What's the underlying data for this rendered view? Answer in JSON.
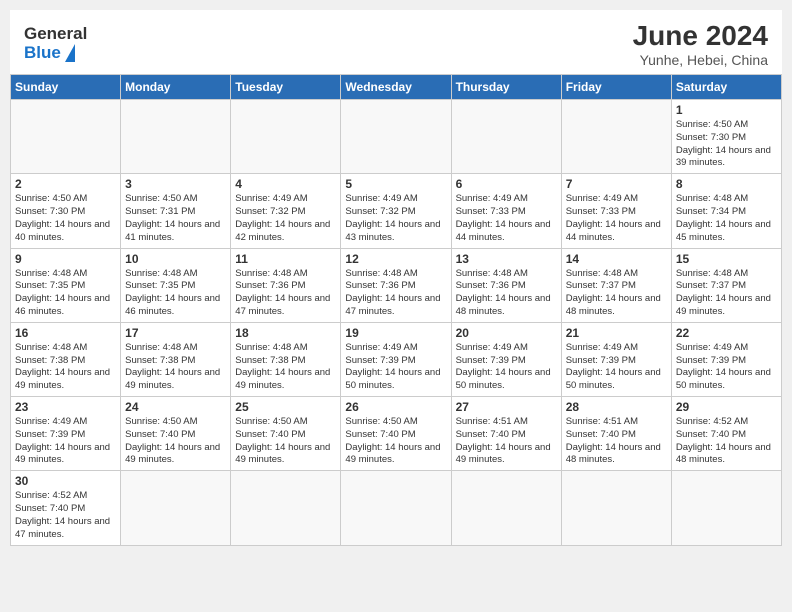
{
  "header": {
    "logo_general": "General",
    "logo_blue": "Blue",
    "month_year": "June 2024",
    "location": "Yunhe, Hebei, China"
  },
  "weekdays": [
    "Sunday",
    "Monday",
    "Tuesday",
    "Wednesday",
    "Thursday",
    "Friday",
    "Saturday"
  ],
  "weeks": [
    [
      {
        "day": "",
        "info": ""
      },
      {
        "day": "",
        "info": ""
      },
      {
        "day": "",
        "info": ""
      },
      {
        "day": "",
        "info": ""
      },
      {
        "day": "",
        "info": ""
      },
      {
        "day": "",
        "info": ""
      },
      {
        "day": "1",
        "info": "Sunrise: 4:50 AM\nSunset: 7:30 PM\nDaylight: 14 hours and 39 minutes."
      }
    ],
    [
      {
        "day": "2",
        "info": "Sunrise: 4:50 AM\nSunset: 7:30 PM\nDaylight: 14 hours and 40 minutes."
      },
      {
        "day": "3",
        "info": "Sunrise: 4:50 AM\nSunset: 7:31 PM\nDaylight: 14 hours and 41 minutes."
      },
      {
        "day": "4",
        "info": "Sunrise: 4:49 AM\nSunset: 7:32 PM\nDaylight: 14 hours and 42 minutes."
      },
      {
        "day": "5",
        "info": "Sunrise: 4:49 AM\nSunset: 7:32 PM\nDaylight: 14 hours and 43 minutes."
      },
      {
        "day": "6",
        "info": "Sunrise: 4:49 AM\nSunset: 7:33 PM\nDaylight: 14 hours and 44 minutes."
      },
      {
        "day": "7",
        "info": "Sunrise: 4:49 AM\nSunset: 7:33 PM\nDaylight: 14 hours and 44 minutes."
      },
      {
        "day": "8",
        "info": "Sunrise: 4:48 AM\nSunset: 7:34 PM\nDaylight: 14 hours and 45 minutes."
      }
    ],
    [
      {
        "day": "9",
        "info": "Sunrise: 4:48 AM\nSunset: 7:35 PM\nDaylight: 14 hours and 46 minutes."
      },
      {
        "day": "10",
        "info": "Sunrise: 4:48 AM\nSunset: 7:35 PM\nDaylight: 14 hours and 46 minutes."
      },
      {
        "day": "11",
        "info": "Sunrise: 4:48 AM\nSunset: 7:36 PM\nDaylight: 14 hours and 47 minutes."
      },
      {
        "day": "12",
        "info": "Sunrise: 4:48 AM\nSunset: 7:36 PM\nDaylight: 14 hours and 47 minutes."
      },
      {
        "day": "13",
        "info": "Sunrise: 4:48 AM\nSunset: 7:36 PM\nDaylight: 14 hours and 48 minutes."
      },
      {
        "day": "14",
        "info": "Sunrise: 4:48 AM\nSunset: 7:37 PM\nDaylight: 14 hours and 48 minutes."
      },
      {
        "day": "15",
        "info": "Sunrise: 4:48 AM\nSunset: 7:37 PM\nDaylight: 14 hours and 49 minutes."
      }
    ],
    [
      {
        "day": "16",
        "info": "Sunrise: 4:48 AM\nSunset: 7:38 PM\nDaylight: 14 hours and 49 minutes."
      },
      {
        "day": "17",
        "info": "Sunrise: 4:48 AM\nSunset: 7:38 PM\nDaylight: 14 hours and 49 minutes."
      },
      {
        "day": "18",
        "info": "Sunrise: 4:48 AM\nSunset: 7:38 PM\nDaylight: 14 hours and 49 minutes."
      },
      {
        "day": "19",
        "info": "Sunrise: 4:49 AM\nSunset: 7:39 PM\nDaylight: 14 hours and 50 minutes."
      },
      {
        "day": "20",
        "info": "Sunrise: 4:49 AM\nSunset: 7:39 PM\nDaylight: 14 hours and 50 minutes."
      },
      {
        "day": "21",
        "info": "Sunrise: 4:49 AM\nSunset: 7:39 PM\nDaylight: 14 hours and 50 minutes."
      },
      {
        "day": "22",
        "info": "Sunrise: 4:49 AM\nSunset: 7:39 PM\nDaylight: 14 hours and 50 minutes."
      }
    ],
    [
      {
        "day": "23",
        "info": "Sunrise: 4:49 AM\nSunset: 7:39 PM\nDaylight: 14 hours and 49 minutes."
      },
      {
        "day": "24",
        "info": "Sunrise: 4:50 AM\nSunset: 7:40 PM\nDaylight: 14 hours and 49 minutes."
      },
      {
        "day": "25",
        "info": "Sunrise: 4:50 AM\nSunset: 7:40 PM\nDaylight: 14 hours and 49 minutes."
      },
      {
        "day": "26",
        "info": "Sunrise: 4:50 AM\nSunset: 7:40 PM\nDaylight: 14 hours and 49 minutes."
      },
      {
        "day": "27",
        "info": "Sunrise: 4:51 AM\nSunset: 7:40 PM\nDaylight: 14 hours and 49 minutes."
      },
      {
        "day": "28",
        "info": "Sunrise: 4:51 AM\nSunset: 7:40 PM\nDaylight: 14 hours and 48 minutes."
      },
      {
        "day": "29",
        "info": "Sunrise: 4:52 AM\nSunset: 7:40 PM\nDaylight: 14 hours and 48 minutes."
      }
    ],
    [
      {
        "day": "30",
        "info": "Sunrise: 4:52 AM\nSunset: 7:40 PM\nDaylight: 14 hours and 47 minutes."
      },
      {
        "day": "",
        "info": ""
      },
      {
        "day": "",
        "info": ""
      },
      {
        "day": "",
        "info": ""
      },
      {
        "day": "",
        "info": ""
      },
      {
        "day": "",
        "info": ""
      },
      {
        "day": "",
        "info": ""
      }
    ]
  ]
}
